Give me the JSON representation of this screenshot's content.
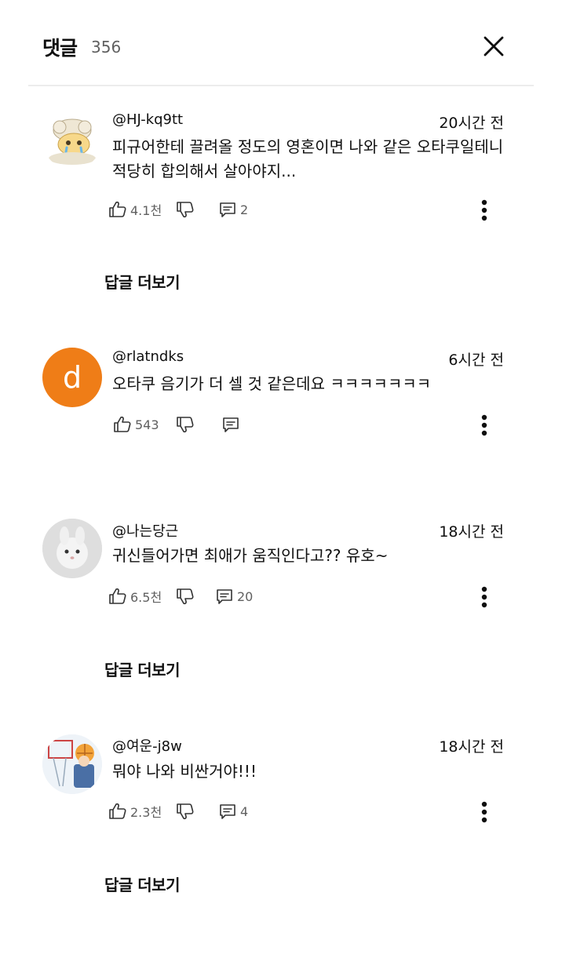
{
  "header": {
    "title": "댓글",
    "count": "356"
  },
  "icons": {
    "close": "close-icon",
    "like": "thumbs-up-icon",
    "dislike": "thumbs-down-icon",
    "reply": "comment-icon",
    "more": "more-vertical-icon"
  },
  "comments": [
    {
      "handle": "@HJ-kq9tt",
      "time": "20시간 전",
      "text_lines": [
        "피규어한테 끌려올 정도의 영혼이면 나와 같은 오타쿠일테니",
        "적당히 합의해서 살아야지..."
      ],
      "likes": "4.1천",
      "replies_count": "2",
      "more_replies": "답글 더보기"
    },
    {
      "handle": "@rlatndks",
      "time": "6시간 전",
      "text_lines": [
        "오타쿠 음기가 더 셀 것 같은데요 ㅋㅋㅋㅋㅋㅋㅋ"
      ],
      "likes": "543",
      "replies_count": "",
      "avatar_letter": "d",
      "avatar_color": "#ef7d17"
    },
    {
      "handle": "@나는당근",
      "time": "18시간 전",
      "text_lines": [
        "귀신들어가면 최애가 움직인다고?? 유호~"
      ],
      "likes": "6.5천",
      "replies_count": "20",
      "more_replies": "답글 더보기"
    },
    {
      "handle": "@여운-j8w",
      "time": "18시간 전",
      "text_lines": [
        "뭐야 나와 비싼거야!!!"
      ],
      "likes": "2.3천",
      "replies_count": "4",
      "more_replies": "답글 더보기"
    }
  ]
}
